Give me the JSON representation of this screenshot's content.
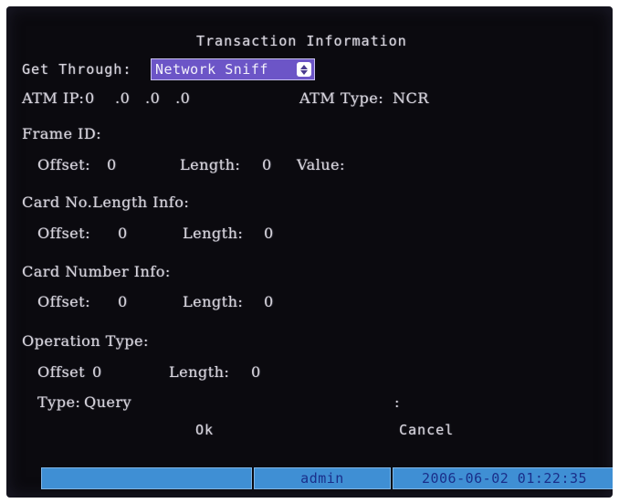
{
  "dialog": {
    "title": "Transaction Information",
    "get_through_label": "Get Through:",
    "get_through_value": "Network Sniff",
    "atm_ip_label": "ATM IP:",
    "atm_ip_value": "0    .0   .0   .0",
    "atm_type_label": "ATM Type:",
    "atm_type_value": "NCR",
    "frame_id": {
      "heading": "Frame ID:",
      "offset_label": "Offset:",
      "offset_value": "0",
      "length_label": "Length:",
      "length_value": "0",
      "value_label": "Value:"
    },
    "card_no_length": {
      "heading": "Card No.Length Info:",
      "offset_label": "Offset:",
      "offset_value": "0",
      "length_label": "Length:",
      "length_value": "0"
    },
    "card_number": {
      "heading": "Card Number Info:",
      "offset_label": "Offset:",
      "offset_value": "0",
      "length_label": "Length:",
      "length_value": "0"
    },
    "operation_type": {
      "heading": "Operation Type:",
      "offset_label": "Offset",
      "offset_value": "0",
      "length_label": "Length:",
      "length_value": "0",
      "type_label": "Type:",
      "type_value": "Query",
      "colon": ":"
    },
    "ok_label": "Ok",
    "cancel_label": "Cancel"
  },
  "status_bar": {
    "user": "admin",
    "datetime": "2006-06-02 01:22:35"
  },
  "colors": {
    "screen_bg": "#0b0a0f",
    "text": "#d7d4dc",
    "select_bg": "#6c55c7",
    "status_bg": "#3f8fd4",
    "status_text": "#1a2f8a"
  },
  "icons": {
    "select_arrow": "up-down-arrow-icon"
  }
}
